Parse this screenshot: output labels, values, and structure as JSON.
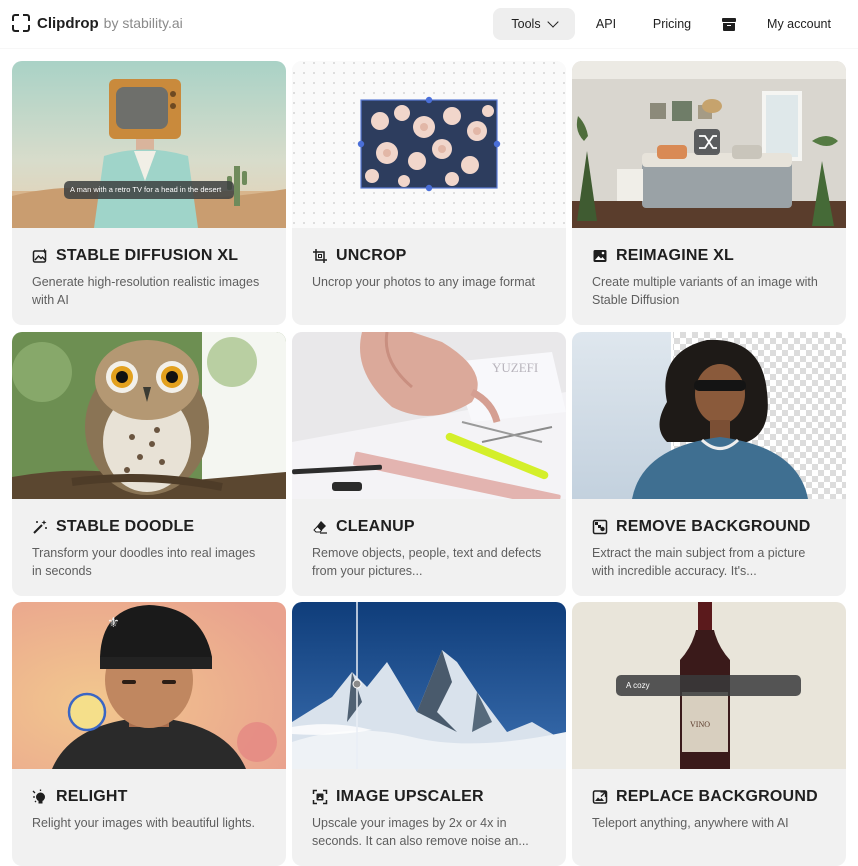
{
  "header": {
    "brand": "Clipdrop",
    "brand_suffix": "by stability.ai",
    "nav": {
      "tools": "Tools",
      "api": "API",
      "pricing": "Pricing",
      "account": "My account"
    }
  },
  "tools": [
    {
      "title": "STABLE DIFFUSION XL",
      "desc": "Generate high-resolution realistic images with AI",
      "thumb_caption": "A man with a retro TV for a head in the desert",
      "icon": "image-sparkle-icon"
    },
    {
      "title": "UNCROP",
      "desc": "Uncrop your photos to any image format",
      "icon": "crop-icon"
    },
    {
      "title": "REIMAGINE XL",
      "desc": "Create multiple variants of an image with Stable Diffusion",
      "icon": "image-variants-icon"
    },
    {
      "title": "STABLE DOODLE",
      "desc": "Transform your doodles into real images in seconds",
      "icon": "magic-wand-icon"
    },
    {
      "title": "CLEANUP",
      "desc": "Remove objects, people, text and defects from your pictures...",
      "icon": "eraser-icon"
    },
    {
      "title": "REMOVE BACKGROUND",
      "desc": "Extract the main subject from a picture with incredible accuracy. It's...",
      "icon": "remove-bg-icon"
    },
    {
      "title": "RELIGHT",
      "desc": "Relight your images with beautiful lights.",
      "icon": "bulb-icon"
    },
    {
      "title": "IMAGE UPSCALER",
      "desc": "Upscale your images by 2x or 4x in seconds. It can also remove noise an...",
      "icon": "upscale-icon"
    },
    {
      "title": "REPLACE BACKGROUND",
      "desc": "Teleport anything, anywhere with AI",
      "thumb_caption": "A cozy",
      "icon": "replace-bg-icon"
    }
  ]
}
